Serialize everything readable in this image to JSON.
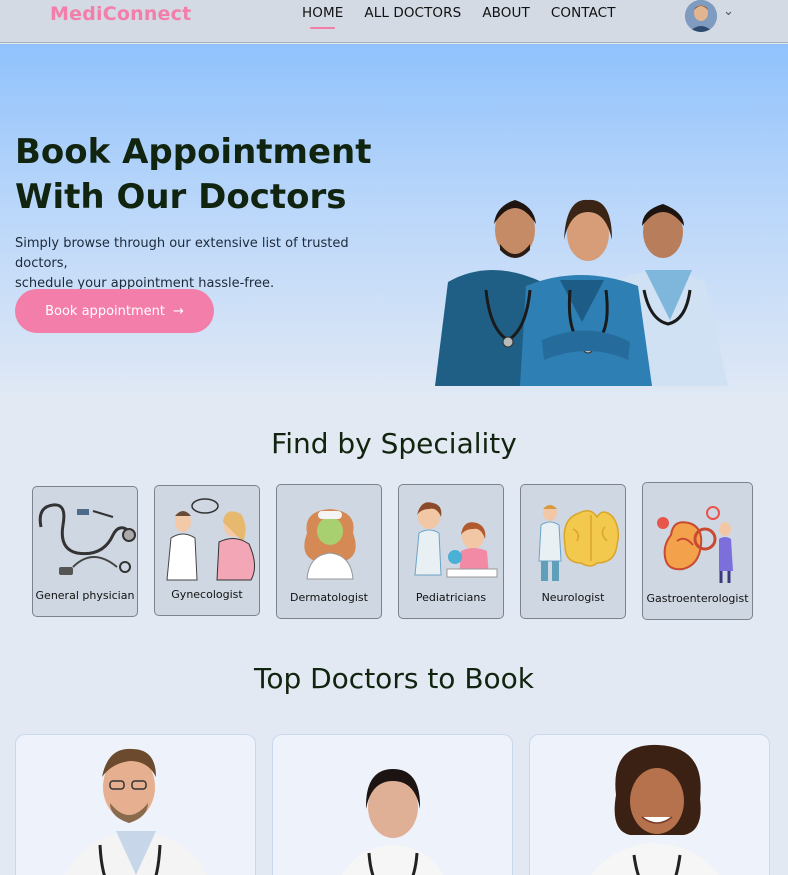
{
  "brand": {
    "name": "MediConnect",
    "accent": "#f27ea9"
  },
  "nav": {
    "links": [
      "HOME",
      "ALL DOCTORS",
      "ABOUT",
      "CONTACT"
    ],
    "active": "HOME"
  },
  "hero": {
    "title_line1": "Book Appointment",
    "title_line2": "With Our Doctors",
    "subtitle_line1": "Simply browse through our extensive list of trusted doctors,",
    "subtitle_line2": "schedule your appointment hassle-free.",
    "button_label": "Book appointment",
    "button_icon": "arrow-right-icon"
  },
  "speciality": {
    "title": "Find by Speciality",
    "items": [
      {
        "label": "General physician",
        "icon": "stethoscope-icon"
      },
      {
        "label": "Gynecologist",
        "icon": "gynecologist-icon"
      },
      {
        "label": "Dermatologist",
        "icon": "dermatologist-icon"
      },
      {
        "label": "Pediatricians",
        "icon": "pediatrician-icon"
      },
      {
        "label": "Neurologist",
        "icon": "brain-icon"
      },
      {
        "label": "Gastroenterologist",
        "icon": "stomach-icon"
      }
    ]
  },
  "top_doctors": {
    "title": "Top Doctors to Book"
  },
  "colors": {
    "header_bg": "#d3dae4",
    "hero_top": "#90c2fc",
    "page_bg": "#e3e9f2",
    "card_bg": "#cfd7e2",
    "title_color": "#102410"
  }
}
